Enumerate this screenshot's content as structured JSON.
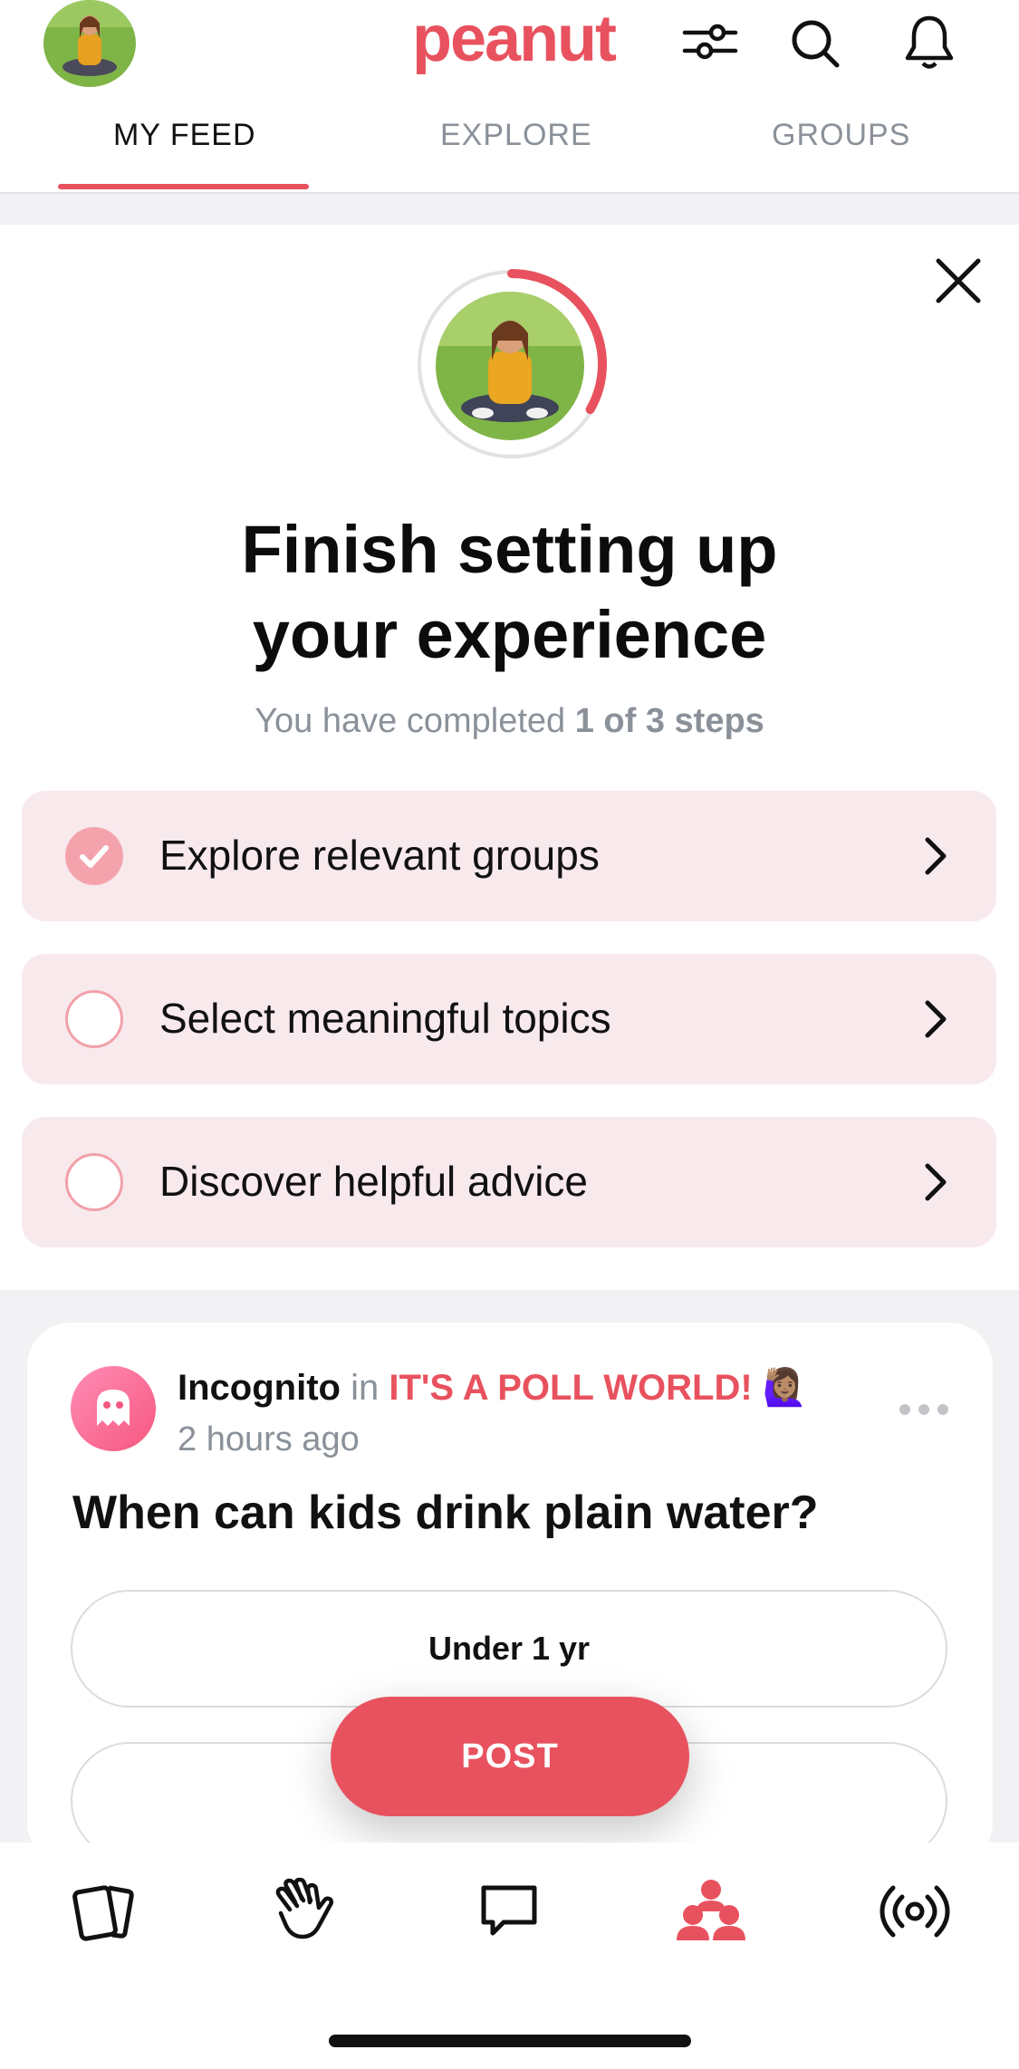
{
  "header": {
    "logo": "peanut",
    "tabs": [
      {
        "label": "MY FEED"
      },
      {
        "label": "EXPLORE"
      },
      {
        "label": "GROUPS"
      }
    ]
  },
  "setup": {
    "title_line1": "Finish setting up",
    "title_line2": "your experience",
    "subtitle_prefix": "You have completed ",
    "subtitle_bold": "1 of 3 steps",
    "progress": 0.3333,
    "steps": [
      {
        "label": "Explore relevant groups",
        "done": true
      },
      {
        "label": "Select meaningful topics",
        "done": false
      },
      {
        "label": "Discover helpful advice",
        "done": false
      }
    ]
  },
  "post": {
    "author": "Incognito",
    "in_word": "in",
    "group": "IT'S A POLL WORLD! 🙋🏽‍♀️",
    "time": "2 hours ago",
    "question": "When can kids drink plain water?",
    "options": [
      "Under 1 yr",
      ""
    ]
  },
  "post_button": "POST",
  "colors": {
    "brand": "#e8525e",
    "step_bg": "#f8e9ed",
    "muted_text": "#8b9199"
  },
  "icons": [
    "filter-icon",
    "search-icon",
    "bell-icon",
    "close-icon",
    "chevron-right-icon",
    "check-icon",
    "ghost-icon",
    "more-icon",
    "cards-icon",
    "wave-icon",
    "chat-icon",
    "groups-icon",
    "broadcast-icon"
  ]
}
